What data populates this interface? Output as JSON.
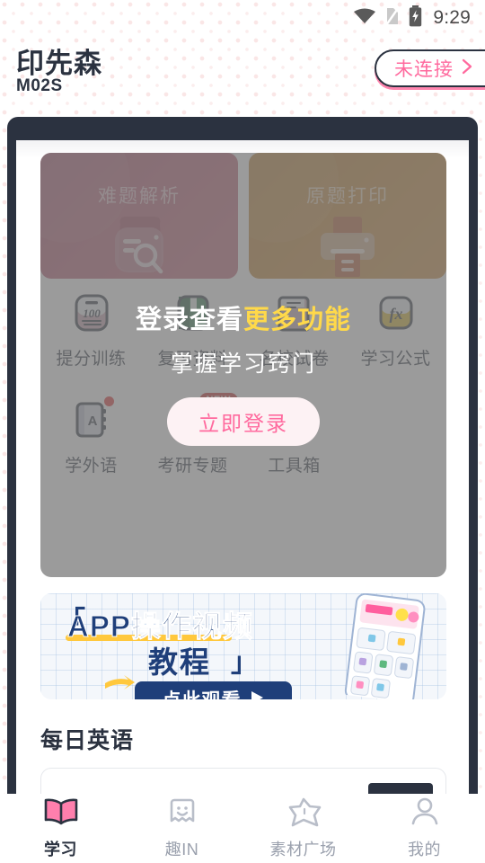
{
  "status_bar": {
    "time": "9:29",
    "icons": [
      "wifi-icon",
      "no-sim-icon",
      "battery-charging-icon"
    ]
  },
  "header": {
    "brand_name": "印先森",
    "model": "M02S",
    "connect_label": "未连接",
    "connect_chevron_icon": "chevron-right-icon",
    "accent_pink": "#ff6a9e",
    "ink_navy": "#2b3240"
  },
  "feature_cards": [
    {
      "title": "难题解析",
      "icon": "scan-camera-icon",
      "color": "#b5586f"
    },
    {
      "title": "原题打印",
      "icon": "printer-icon",
      "color": "#bf7f2c"
    }
  ],
  "icon_grid": {
    "row1": [
      {
        "label": "提分训练",
        "icon": "score-100-icon"
      },
      {
        "label": "复习资料",
        "icon": "green-book-icon"
      },
      {
        "label": "名校试卷",
        "icon": "exam-paper-icon"
      },
      {
        "label": "学习公式",
        "icon": "fx-formula-icon"
      }
    ],
    "row2": [
      {
        "label": "学外语",
        "icon": "language-book-icon",
        "badge": "dot"
      },
      {
        "label": "考研专题",
        "icon": "graduation-cap-icon",
        "badge": "NEW"
      },
      {
        "label": "工具箱",
        "icon": "toolbox-icon",
        "badge": ""
      }
    ]
  },
  "login_overlay": {
    "title_plain": "登录查看",
    "title_highlight": "更多功能",
    "subtitle": "掌握学习窍门",
    "button_label": "立即登录",
    "highlight_color": "#ffd94a",
    "button_text_color": "#ff6a9e"
  },
  "video_banner": {
    "bracket_left": "「",
    "line1": "APP操作视频",
    "line2": "教程",
    "bracket_right": "」",
    "cta_label": "点此观看",
    "cta_icon": "play-triangle-icon",
    "phone_icon": "phone-mockup-icon"
  },
  "daily_section": {
    "title": "每日英语"
  },
  "bottom_nav": {
    "items": [
      {
        "label": "学习",
        "icon": "open-book-icon",
        "active": true
      },
      {
        "label": "趣IN",
        "icon": "ghost-face-icon",
        "active": false
      },
      {
        "label": "素材广场",
        "icon": "star-icon",
        "active": false
      },
      {
        "label": "我的",
        "icon": "person-icon",
        "active": false
      }
    ]
  }
}
